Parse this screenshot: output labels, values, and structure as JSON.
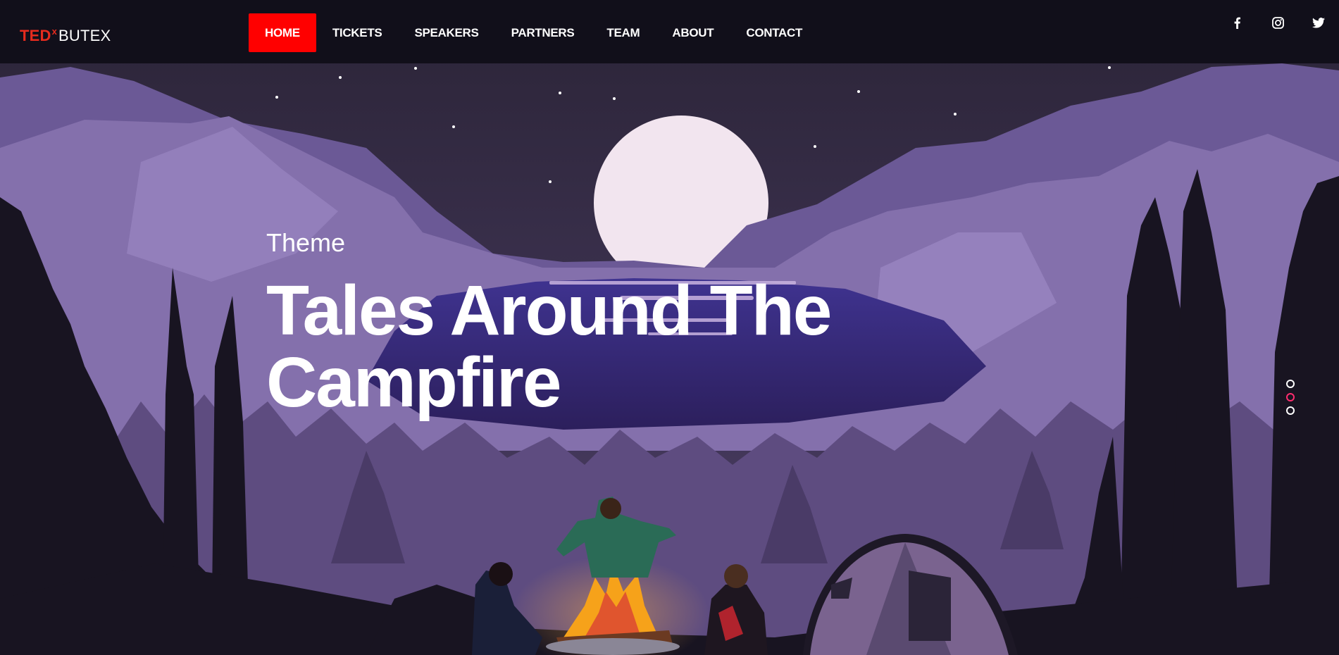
{
  "brand": {
    "prefix": "TED",
    "superscript": "x",
    "name": "BUTEX"
  },
  "nav": {
    "items": [
      {
        "label": "HOME",
        "active": true
      },
      {
        "label": "TICKETS",
        "active": false
      },
      {
        "label": "SPEAKERS",
        "active": false
      },
      {
        "label": "PARTNERS",
        "active": false
      },
      {
        "label": "TEAM",
        "active": false
      },
      {
        "label": "ABOUT",
        "active": false
      },
      {
        "label": "CONTACT",
        "active": false
      }
    ],
    "active_color": "#ff0000"
  },
  "social": [
    {
      "icon": "facebook-icon"
    },
    {
      "icon": "instagram-icon"
    },
    {
      "icon": "twitter-icon"
    }
  ],
  "hero": {
    "kicker": "Theme",
    "title": "Tales Around The Campfire",
    "slides": {
      "count": 3,
      "active": 2
    },
    "slide_active_color": "#ff2d6f"
  },
  "colors": {
    "brand_red": "#e62b1e",
    "nav_bg": "#110f1a"
  }
}
